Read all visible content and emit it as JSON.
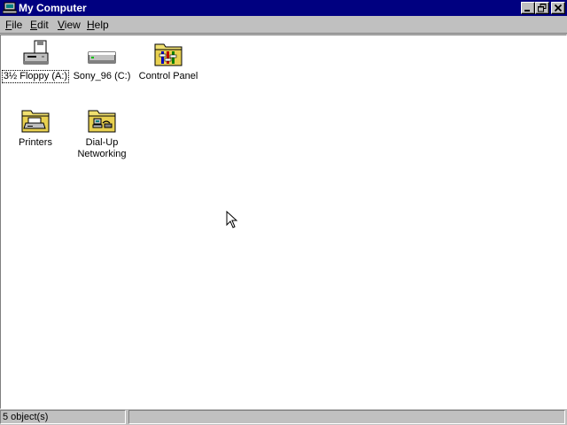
{
  "window": {
    "title": "My Computer",
    "controls": {
      "minimize": "minimize-icon",
      "restore": "restore-icon",
      "close": "close-icon"
    }
  },
  "menu": {
    "items": [
      {
        "label": "File",
        "accel": "F",
        "rest": "ile"
      },
      {
        "label": "Edit",
        "accel": "E",
        "rest": "dit"
      },
      {
        "label": "View",
        "accel": "V",
        "rest": "iew"
      },
      {
        "label": "Help",
        "accel": "H",
        "rest": "elp"
      }
    ]
  },
  "icons": [
    {
      "label": "3½ Floppy (A:)",
      "icon": "floppy-drive-icon",
      "selected": true
    },
    {
      "label": "Sony_96 (C:)",
      "icon": "hard-drive-icon",
      "selected": false
    },
    {
      "label": "Control Panel",
      "icon": "control-panel-folder-icon",
      "selected": false
    },
    {
      "label": "Printers",
      "icon": "printers-folder-icon",
      "selected": false
    },
    {
      "label": "Dial-Up Networking",
      "icon": "dialup-networking-folder-icon",
      "selected": false
    }
  ],
  "status": {
    "objects": "5 object(s)",
    "secondary": ""
  },
  "colors": {
    "titlebar": "#000080",
    "face": "#c0c0c0",
    "folder": "#f0e070",
    "window": "#ffffff"
  }
}
